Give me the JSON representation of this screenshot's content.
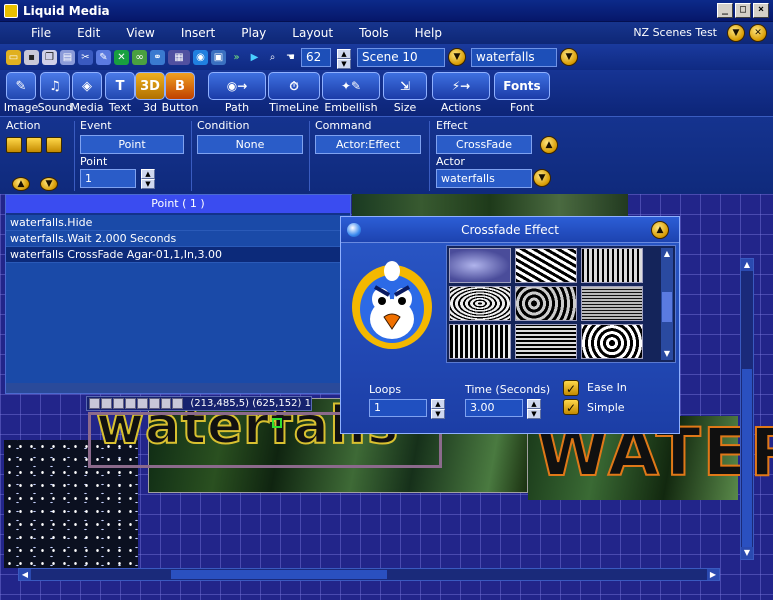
{
  "window": {
    "title": "Liquid Media"
  },
  "menu": {
    "items": [
      "File",
      "Edit",
      "View",
      "Insert",
      "Play",
      "Layout",
      "Tools",
      "Help"
    ],
    "scene_title": "NZ Scenes Test"
  },
  "toolbar": {
    "zoom_value": "62",
    "scene_select": "Scene 10",
    "actor_select": "waterfalls"
  },
  "tools": [
    {
      "label": "Image",
      "icon": "image-icon"
    },
    {
      "label": "Sound",
      "icon": "sound-icon"
    },
    {
      "label": "Media",
      "icon": "media-icon"
    },
    {
      "label": "Text",
      "icon": "text-icon"
    },
    {
      "label": "3d",
      "icon": "3d-icon"
    },
    {
      "label": "Button",
      "icon": "button-icon"
    },
    {
      "label": "Path",
      "icon": "path-icon"
    },
    {
      "label": "TimeLine",
      "icon": "timeline-icon"
    },
    {
      "label": "Embellish",
      "icon": "embellish-icon"
    },
    {
      "label": "Size",
      "icon": "size-icon"
    },
    {
      "label": "Actions",
      "icon": "actions-icon"
    },
    {
      "label": "Font",
      "icon": "font-icon",
      "badge": "Fonts"
    }
  ],
  "action_panel": {
    "action_label": "Action",
    "event_label": "Event",
    "event_value": "Point",
    "point_label": "Point",
    "point_value": "1",
    "condition_label": "Condition",
    "condition_value": "None",
    "command_label": "Command",
    "command_value": "Actor:Effect",
    "effect_label": "Effect",
    "effect_value": "CrossFade",
    "actor_label": "Actor",
    "actor_value": "waterfalls"
  },
  "point_panel": {
    "header": "Point ( 1 )",
    "rows": [
      "waterfalls.Hide",
      "waterfalls.Wait 2.000 Seconds",
      "waterfalls CrossFade Agar-01,1,In,3.00"
    ]
  },
  "coords": {
    "text": "(213,485,5) (625,152)  1"
  },
  "canvas": {
    "text_left": "waterfalls",
    "text_right": "WATER"
  },
  "dialog": {
    "title": "Crossfade Effect",
    "loops_label": "Loops",
    "loops_value": "1",
    "time_label": "Time (Seconds)",
    "time_value": "3.00",
    "ease_in_label": "Ease In",
    "simple_label": "Simple"
  }
}
